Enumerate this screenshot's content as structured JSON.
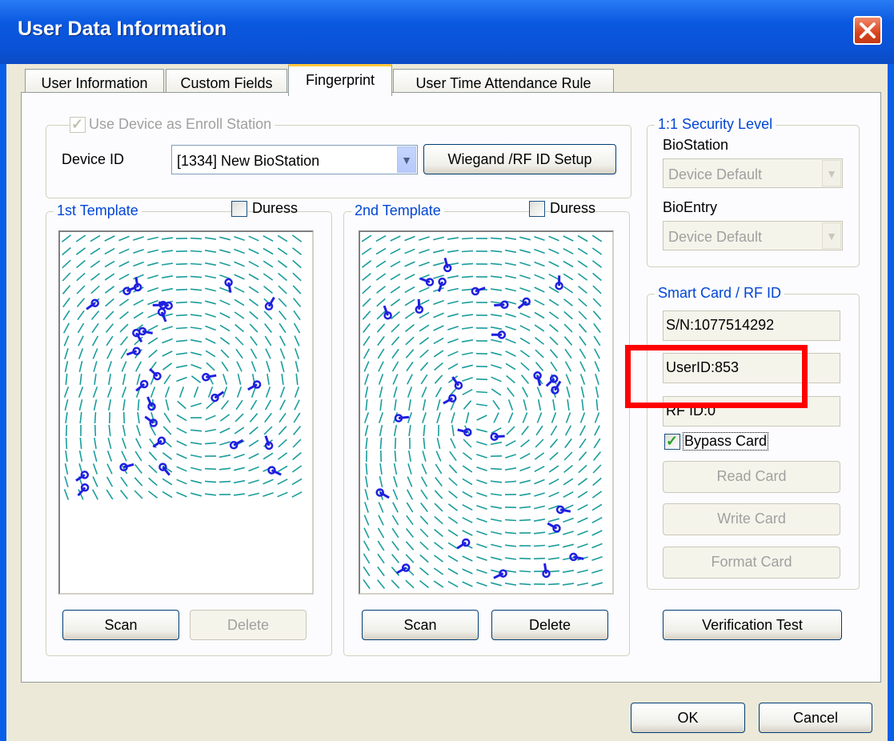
{
  "window": {
    "title": "User Data Information"
  },
  "tabs": [
    {
      "label": "User Information",
      "selected": false
    },
    {
      "label": "Custom Fields",
      "selected": false
    },
    {
      "label": "Fingerprint",
      "selected": true
    },
    {
      "label": "User Time Attendance Rule",
      "selected": false
    }
  ],
  "enroll": {
    "use_device_label": "Use Device as Enroll Station",
    "use_device_checked": true,
    "device_id_label": "Device ID",
    "device_value": "[1334] New BioStation",
    "wiegand_button": "Wiegand /RF ID Setup"
  },
  "template1": {
    "title": "1st Template",
    "duress_label": "Duress",
    "duress_checked": false,
    "scan_button": "Scan",
    "delete_button": "Delete",
    "delete_enabled": false
  },
  "template2": {
    "title": "2nd Template",
    "duress_label": "Duress",
    "duress_checked": false,
    "scan_button": "Scan",
    "delete_button": "Delete",
    "delete_enabled": true
  },
  "security": {
    "title": "1:1 Security Level",
    "biostation_label": "BioStation",
    "biostation_value": "Device Default",
    "bioentry_label": "BioEntry",
    "bioentry_value": "Device Default"
  },
  "smartcard": {
    "title": "Smart Card / RF ID",
    "sn_value": "S/N:1077514292",
    "userid_value": "UserID:853",
    "rfid_value": "RF ID:0",
    "bypass_label": "Bypass Card",
    "bypass_checked": true,
    "read_button": "Read Card",
    "write_button": "Write Card",
    "format_button": "Format Card"
  },
  "verification_button": "Verification Test",
  "footer": {
    "ok_button": "OK",
    "cancel_button": "Cancel"
  },
  "colors": {
    "highlight": "#ff0000",
    "fp_ridge": "#1a9c9c",
    "fp_minutia": "#1f1fe0",
    "title_bar": "#0a59e0"
  },
  "icons": {
    "close": "close-icon",
    "dropdown": "chevron-down-icon",
    "check": "checkmark-icon"
  }
}
